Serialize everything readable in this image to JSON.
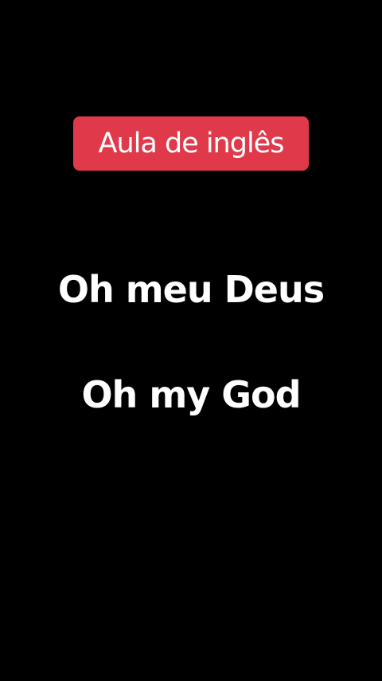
{
  "badge": {
    "label": "Aula de inglês",
    "color": "#e03a4a"
  },
  "phrases": {
    "portuguese": "Oh meu Deus",
    "english": "Oh my God"
  },
  "colors": {
    "background": "#000000",
    "text": "#ffffff"
  }
}
